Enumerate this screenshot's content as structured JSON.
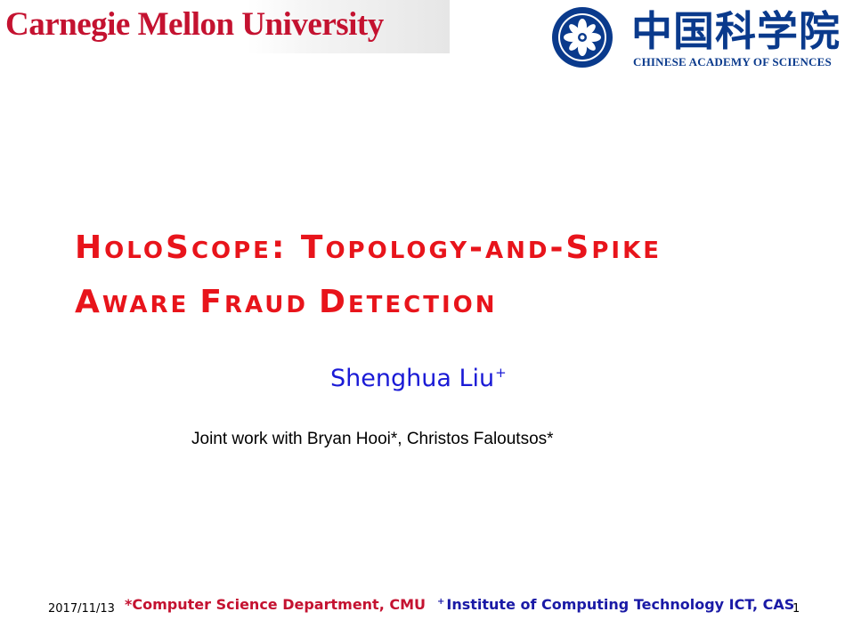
{
  "logos": {
    "cmu_text": "Carnegie Mellon University",
    "cas_chinese": "中国科学院",
    "cas_english": "CHINESE ACADEMY OF SCIENCES",
    "cmu_color": "#c41230",
    "cas_color": "#0a3a8c"
  },
  "title": {
    "line1": [
      {
        "text": "H",
        "big": true
      },
      {
        "text": "OLO",
        "big": false
      },
      {
        "text": "S",
        "big": true
      },
      {
        "text": "COPE",
        "big": false
      },
      {
        "text": ": T",
        "big": true
      },
      {
        "text": "OPOLOGY",
        "big": false
      },
      {
        "text": "-",
        "big": true
      },
      {
        "text": "AND",
        "big": false
      },
      {
        "text": "-S",
        "big": true
      },
      {
        "text": "PIKE",
        "big": false
      }
    ],
    "line2": [
      {
        "text": "A",
        "big": true
      },
      {
        "text": "WARE ",
        "big": false
      },
      {
        "text": "F",
        "big": true
      },
      {
        "text": "RAUD ",
        "big": false
      },
      {
        "text": "D",
        "big": true
      },
      {
        "text": "ETECTION",
        "big": false
      }
    ],
    "color": "#e8141b"
  },
  "author": {
    "name": "Shenghua Liu",
    "mark": "+",
    "color": "#1a1ad6"
  },
  "joint_work": "Joint work with Bryan Hooi*, Christos Faloutsos*",
  "footer": {
    "date": "2017/11/13",
    "cmu_affiliation": "*Computer Science Department, CMU",
    "cas_mark": "+",
    "cas_affiliation": "Institute of Computing Technology ICT, CAS",
    "page_number": "1"
  }
}
